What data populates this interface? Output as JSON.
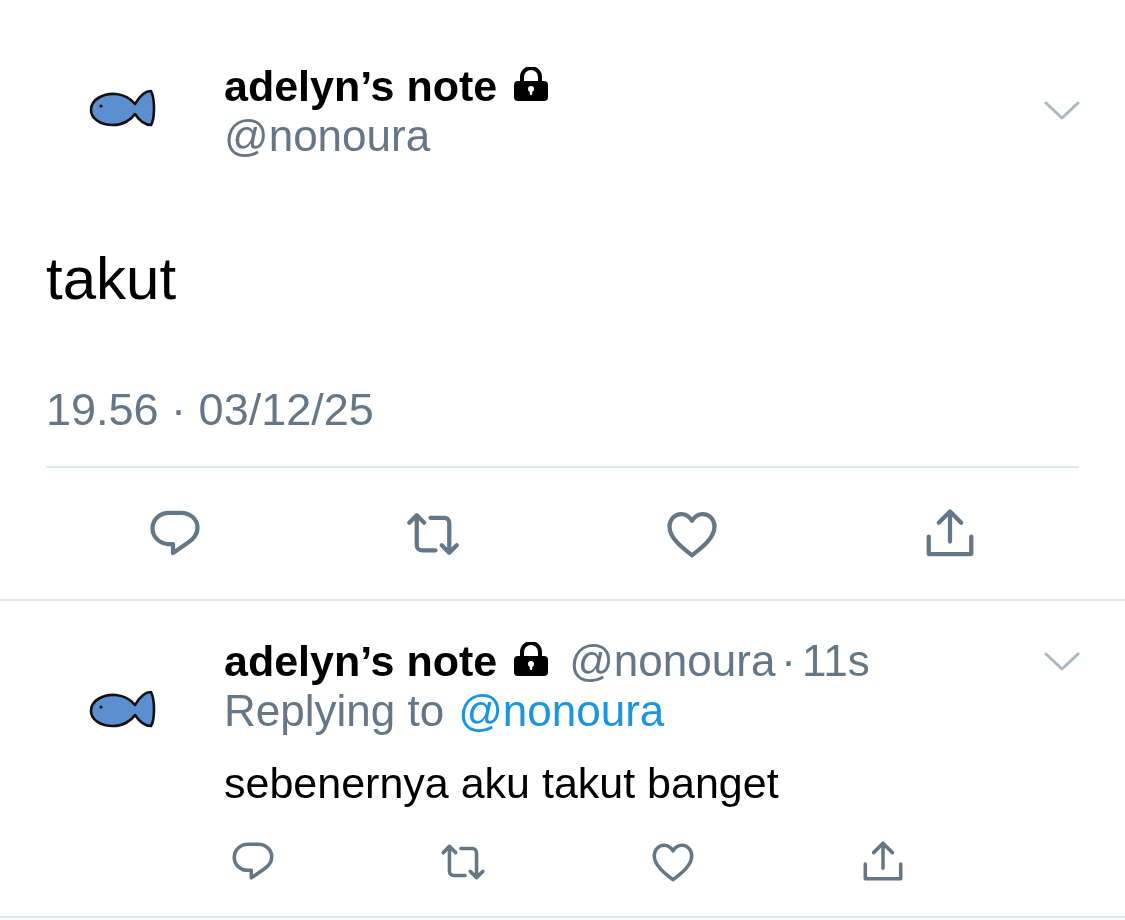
{
  "tweet": {
    "author": {
      "name": "adelyn’s note",
      "protected": true,
      "handle": "@nonoura"
    },
    "text": "takut",
    "timestamp": "19.56 · 03/12/25"
  },
  "reply": {
    "author": {
      "name": "adelyn’s note",
      "protected": true,
      "handle": "@nonoura"
    },
    "separator": "·",
    "time": "11s",
    "replying_to": {
      "label": "Replying to",
      "handle": "@nonoura"
    },
    "text": "sebenernya aku takut banget"
  }
}
